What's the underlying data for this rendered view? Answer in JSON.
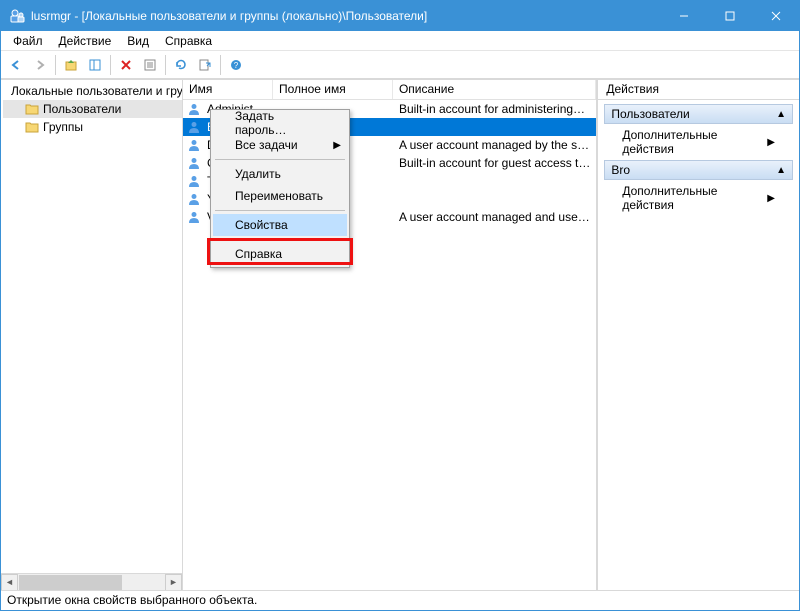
{
  "window": {
    "title": "lusrmgr - [Локальные пользователи и группы (локально)\\Пользователи]"
  },
  "menubar": {
    "items": [
      "Файл",
      "Действие",
      "Вид",
      "Справка"
    ]
  },
  "tree": {
    "root": "Локальные пользователи и группы",
    "children": [
      {
        "label": "Пользователи",
        "selected": true
      },
      {
        "label": "Группы",
        "selected": false
      }
    ]
  },
  "list": {
    "columns": [
      "Имя",
      "Полное имя",
      "Описание"
    ],
    "rows": [
      {
        "name": "Administrator",
        "full": "",
        "desc": "Built-in account for administering…",
        "selected": false
      },
      {
        "name": "B",
        "full": "",
        "desc": "",
        "selected": true
      },
      {
        "name": "D",
        "full": "",
        "desc": "A user account managed by the s…",
        "selected": false
      },
      {
        "name": "G",
        "full": "",
        "desc": "Built-in account for guest access t…",
        "selected": false
      },
      {
        "name": "T",
        "full": "",
        "desc": "",
        "selected": false
      },
      {
        "name": "Y",
        "full": "",
        "desc": "",
        "selected": false
      },
      {
        "name": "V",
        "full": "",
        "desc": "A user account managed and use…",
        "selected": false
      }
    ]
  },
  "context_menu": {
    "items": [
      {
        "label": "Задать пароль…",
        "type": "item"
      },
      {
        "label": "Все задачи",
        "type": "submenu"
      },
      {
        "type": "sep"
      },
      {
        "label": "Удалить",
        "type": "item"
      },
      {
        "label": "Переименовать",
        "type": "item"
      },
      {
        "type": "sep"
      },
      {
        "label": "Свойства",
        "type": "item",
        "highlight": true
      },
      {
        "type": "sep"
      },
      {
        "label": "Справка",
        "type": "item"
      }
    ]
  },
  "actions": {
    "title": "Действия",
    "groups": [
      {
        "header": "Пользователи",
        "items": [
          "Дополнительные действия"
        ]
      },
      {
        "header": "Bro",
        "items": [
          "Дополнительные действия"
        ]
      }
    ]
  },
  "statusbar": "Открытие окна свойств выбранного объекта."
}
